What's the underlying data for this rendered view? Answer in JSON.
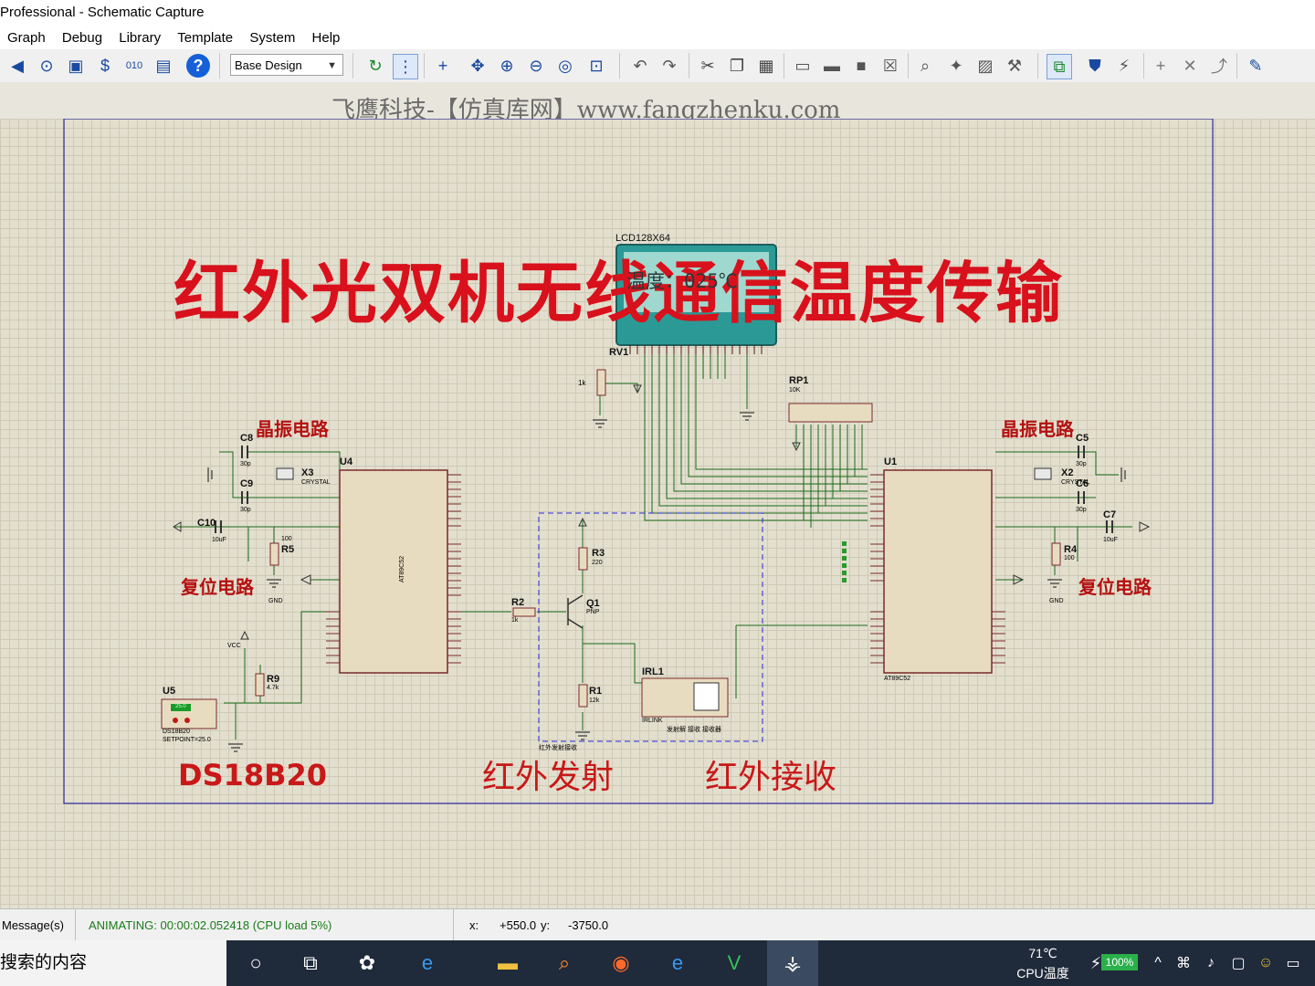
{
  "window": {
    "title": "Professional - Schematic Capture"
  },
  "menu": [
    "Graph",
    "Debug",
    "Library",
    "Template",
    "System",
    "Help"
  ],
  "toolbar": {
    "design_select": "Base Design"
  },
  "watermark": "飞鹰科技-【仿真库网】www.fangzhenku.com",
  "schematic": {
    "title": "红外光双机无线通信温度传输",
    "labels": {
      "crystal_left": "晶振电路",
      "crystal_right": "晶振电路",
      "reset_left": "复位电路",
      "reset_right": "复位电路",
      "ds18b20": "DS18B20",
      "ir_tx": "红外发射",
      "ir_rx": "红外接收"
    },
    "lcd": {
      "name": "LCD128X64",
      "display": "温度：025℃"
    },
    "components": {
      "rv1": "RV1",
      "rp1": "RP1",
      "rp1_val": "10K",
      "u4": "U4",
      "u1": "U1",
      "u5": "U5",
      "c8": "C8",
      "c9": "C9",
      "c10": "C10",
      "c5": "C5",
      "c6": "C6",
      "c7": "C7",
      "x3": "X3",
      "x2": "X2",
      "crystal": "CRYSTAL",
      "r5": "R5",
      "r4": "R4",
      "r9": "R9",
      "r2": "R2",
      "r3": "R3",
      "r1": "R1",
      "q1": "Q1",
      "pnp": "PNP",
      "irl1": "IRL1",
      "irlink": "IRLINK",
      "at89c52": "AT89C52",
      "ds_name": "DS18B20",
      "setpoint": "SETPOINT=25.0",
      "ds_val": "25.0",
      "vcc": "VCC",
      "gnd": "GND",
      "c30p": "30p",
      "c10uf": "10uF",
      "r100": "100",
      "r220": "220",
      "r12k": "12k",
      "r47k": "4.7k",
      "r1k": "1k",
      "ir_box": "红外发射接收",
      "ir_sub": "发射解    接收  接收器"
    }
  },
  "status": {
    "messages": "Message(s)",
    "animating": "ANIMATING: 00:00:02.052418 (CPU load 5%)",
    "x_label": "x:",
    "x_val": "+550.0",
    "y_label": "y:",
    "y_val": "-3750.0"
  },
  "taskbar": {
    "search_text": "搜索的内容",
    "temp": "71℃",
    "temp_label": "CPU温度",
    "battery": "100%"
  }
}
